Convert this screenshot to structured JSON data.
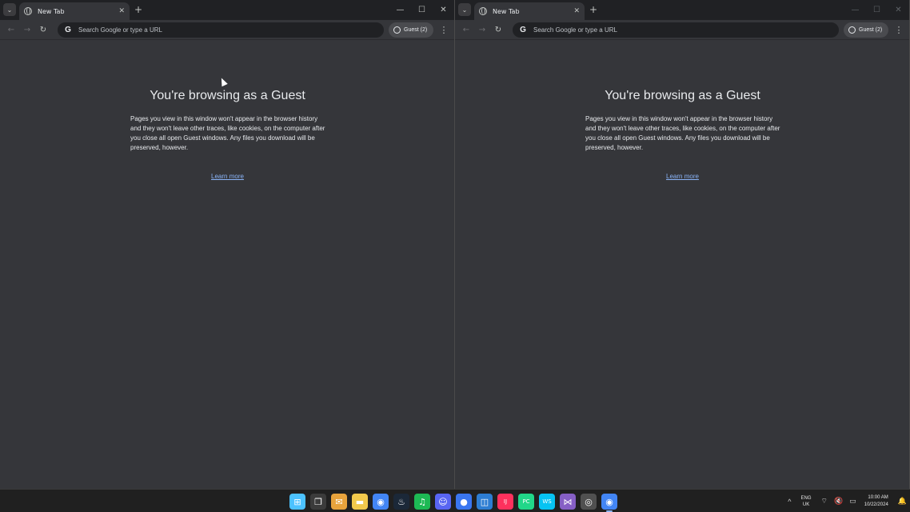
{
  "windows": [
    {
      "tab": {
        "title": "New Tab",
        "close": "✕"
      },
      "new_tab": "+",
      "controls": {
        "minimize": "—",
        "maximize": "☐",
        "close": "✕"
      },
      "omnibox": {
        "google": "G",
        "placeholder": "Search Google or type a URL"
      },
      "profile": {
        "label": "Guest (2)"
      },
      "menu": "⋮",
      "content": {
        "title": "You're browsing as a Guest",
        "description": "Pages you view in this window won't appear in the browser history and they won't leave other traces, like cookies, on the computer after you close all open Guest windows. Any files you download will be preserved, however.",
        "learn_more": "Learn more"
      }
    },
    {
      "tab": {
        "title": "New Tab",
        "close": "✕"
      },
      "new_tab": "+",
      "controls": {
        "minimize": "—",
        "maximize": "☐",
        "close": "✕"
      },
      "omnibox": {
        "google": "G",
        "placeholder": "Search Google or type a URL"
      },
      "profile": {
        "label": "Guest (2)"
      },
      "menu": "⋮",
      "content": {
        "title": "You're browsing as a Guest",
        "description": "Pages you view in this window won't appear in the browser history and they won't leave other traces, like cookies, on the computer after you close all open Guest windows. Any files you download will be preserved, however.",
        "learn_more": "Learn more"
      }
    }
  ],
  "nav_icons": {
    "back": "←",
    "forward": "→",
    "reload": "↻",
    "tab_search": "⌄"
  },
  "taskbar": {
    "apps": [
      {
        "name": "windows-start",
        "glyph": "⊞",
        "color": "#4cc2ff"
      },
      {
        "name": "task-view",
        "glyph": "❐",
        "color": "#3b3b3b"
      },
      {
        "name": "file-explorer-mail",
        "glyph": "✉",
        "color": "#e8a33c"
      },
      {
        "name": "file-explorer",
        "glyph": "▬",
        "color": "#f2c94c"
      },
      {
        "name": "chrome",
        "glyph": "◉",
        "color": "#4285f4"
      },
      {
        "name": "steam",
        "glyph": "♨",
        "color": "#1b2838"
      },
      {
        "name": "spotify",
        "glyph": "♫",
        "color": "#1db954"
      },
      {
        "name": "discord",
        "glyph": "☺",
        "color": "#5865f2"
      },
      {
        "name": "signal",
        "glyph": "●",
        "color": "#3a76f0"
      },
      {
        "name": "app-orange",
        "glyph": "◫",
        "color": "#2d7dd2"
      },
      {
        "name": "intellij",
        "glyph": "IJ",
        "color": "#fe315d"
      },
      {
        "name": "pycharm",
        "glyph": "PC",
        "color": "#21d789"
      },
      {
        "name": "webstorm",
        "glyph": "WS",
        "color": "#07c3f2"
      },
      {
        "name": "visual-studio",
        "glyph": "⋈",
        "color": "#865fc5"
      },
      {
        "name": "obs",
        "glyph": "◎",
        "color": "#505050"
      },
      {
        "name": "chrome-active",
        "glyph": "◉",
        "color": "#4285f4"
      }
    ],
    "tray": {
      "chevron": "^",
      "lang_top": "ENG",
      "lang_bottom": "UK",
      "wifi": "⌔",
      "volume": "🔇",
      "battery": "▭",
      "time": "10:00 AM",
      "date": "10/22/2024",
      "bell": "🔔"
    }
  }
}
